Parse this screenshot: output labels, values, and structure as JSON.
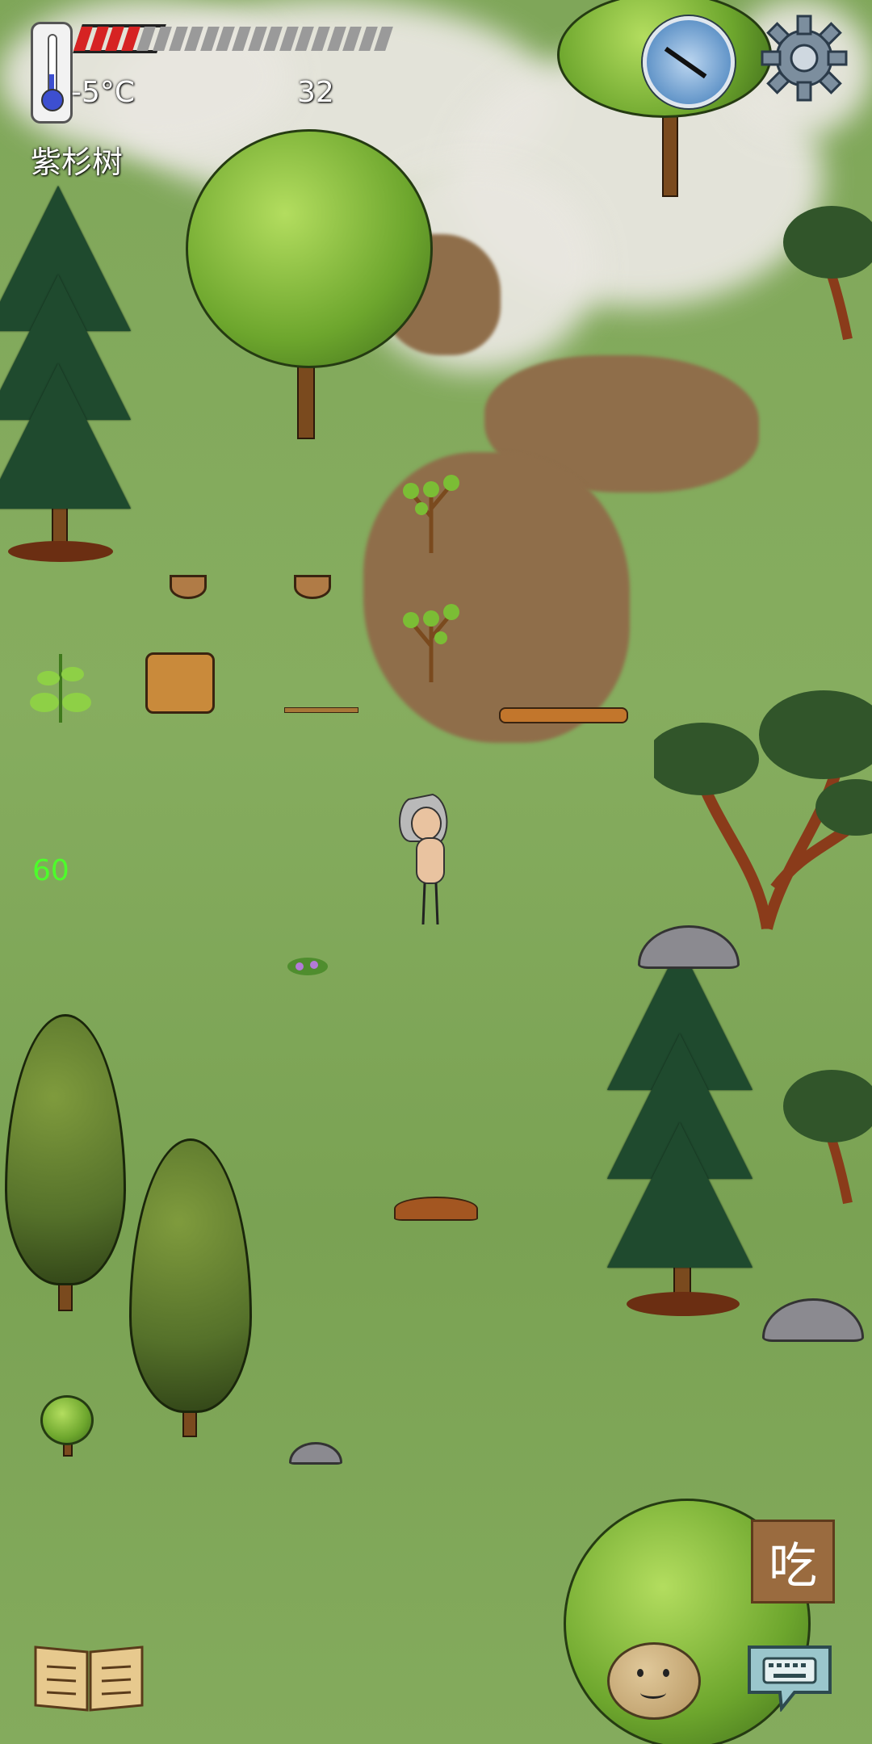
{
  "hud": {
    "temperature": "-5°C",
    "player_age": "32",
    "held_object_name": "紫杉树",
    "fps": "60",
    "food_segments_total": 20,
    "food_segments_filled": 4,
    "compass_icon": "compass-icon",
    "settings_icon": "gear-icon"
  },
  "actions": {
    "eat_label": "吃"
  },
  "colors": {
    "grass": "#7fa659",
    "fog": "#e9e7e0",
    "dirt": "#8f6e4a",
    "food_filled": "#d62323",
    "fps_text": "#4cff2a",
    "eat_button": "#9a6b3f"
  }
}
